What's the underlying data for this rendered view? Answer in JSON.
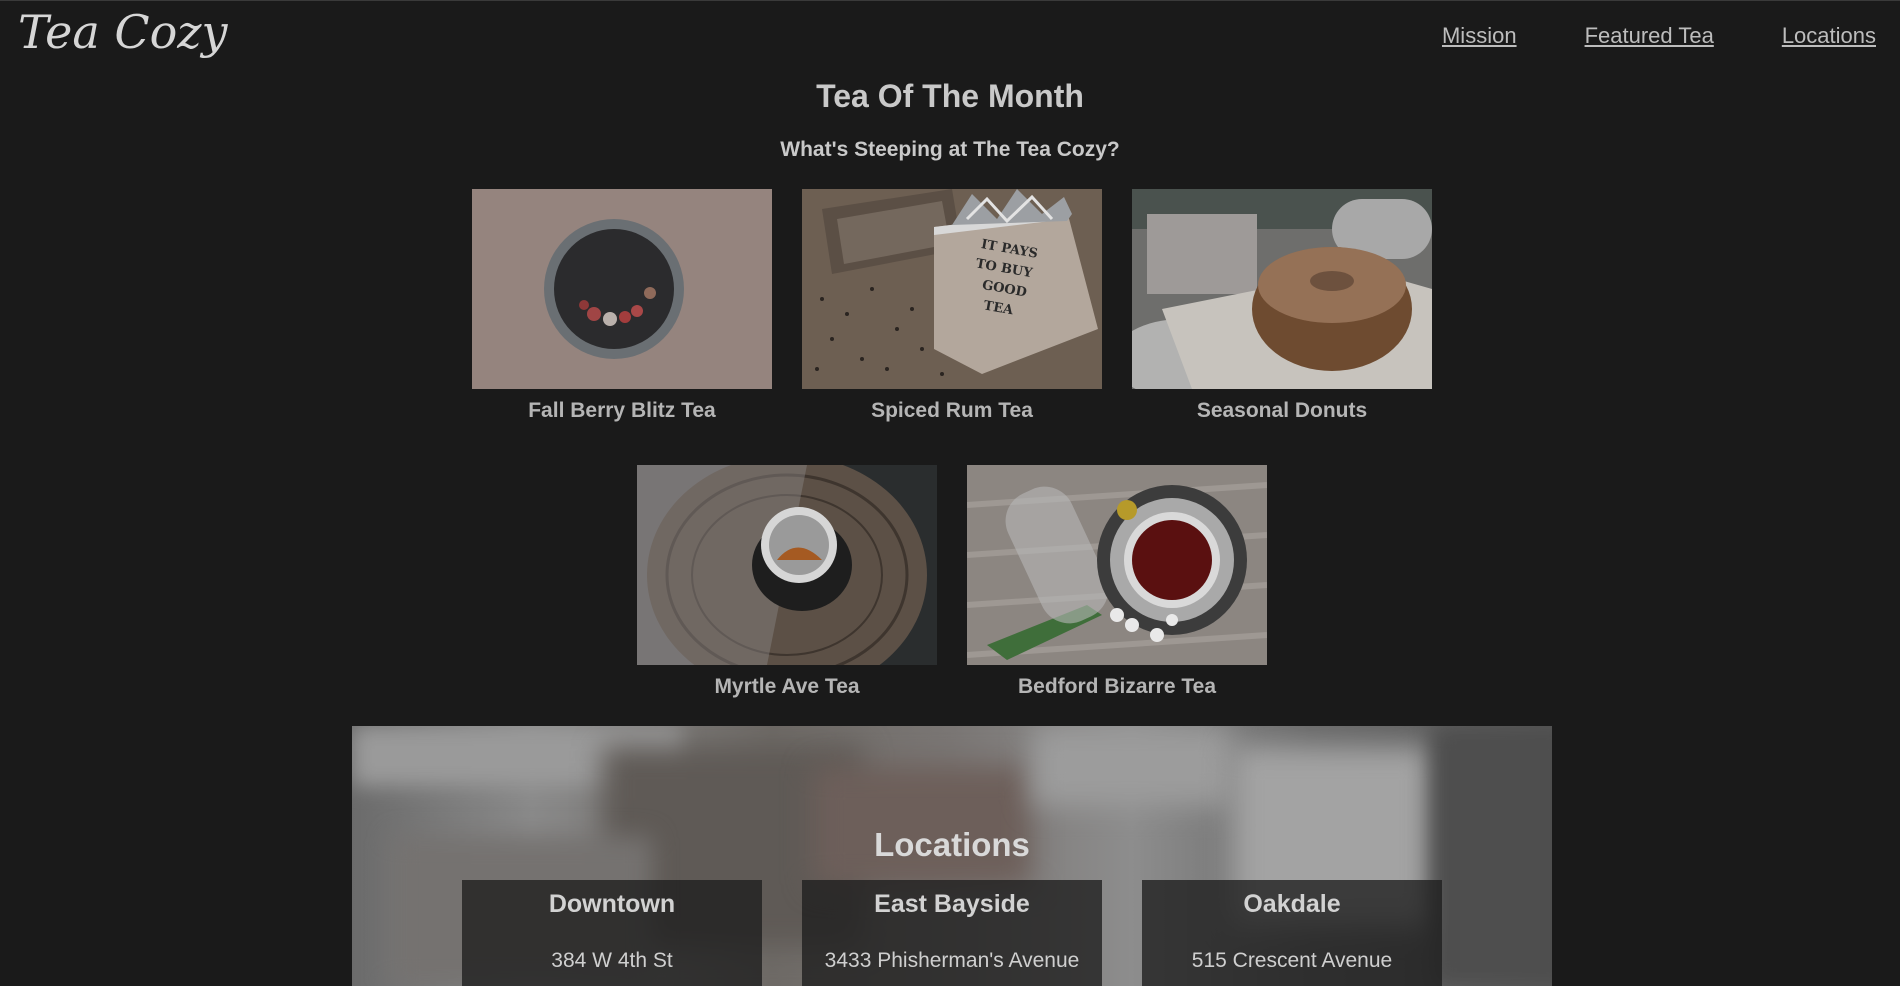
{
  "brand": {
    "logo_text": "Tea Cozy"
  },
  "nav": {
    "items": [
      {
        "label": "Mission"
      },
      {
        "label": "Featured Tea"
      },
      {
        "label": "Locations"
      }
    ]
  },
  "featured": {
    "title": "Tea Of The Month",
    "subtitle": "What's Steeping at The Tea Cozy?",
    "items": [
      {
        "label": "Fall Berry Blitz Tea",
        "image": "mug-with-berries-photo"
      },
      {
        "label": "Spiced Rum Tea",
        "image": "tea-box-it-pays-to-buy-good-tea-photo",
        "image_text": "IT PAYS TO BUY GOOD TEA"
      },
      {
        "label": "Seasonal Donuts",
        "image": "sugared-donut-photo"
      },
      {
        "label": "Myrtle Ave Tea",
        "image": "tea-cup-on-wood-photo"
      },
      {
        "label": "Bedford Bizarre Tea",
        "image": "red-tea-cup-with-flowers-photo"
      }
    ]
  },
  "locations": {
    "title": "Locations",
    "items": [
      {
        "name": "Downtown",
        "address": "384 W 4th St"
      },
      {
        "name": "East Bayside",
        "address": "3433 Phisherman's Avenue"
      },
      {
        "name": "Oakdale",
        "address": "515 Crescent Avenue"
      }
    ]
  }
}
